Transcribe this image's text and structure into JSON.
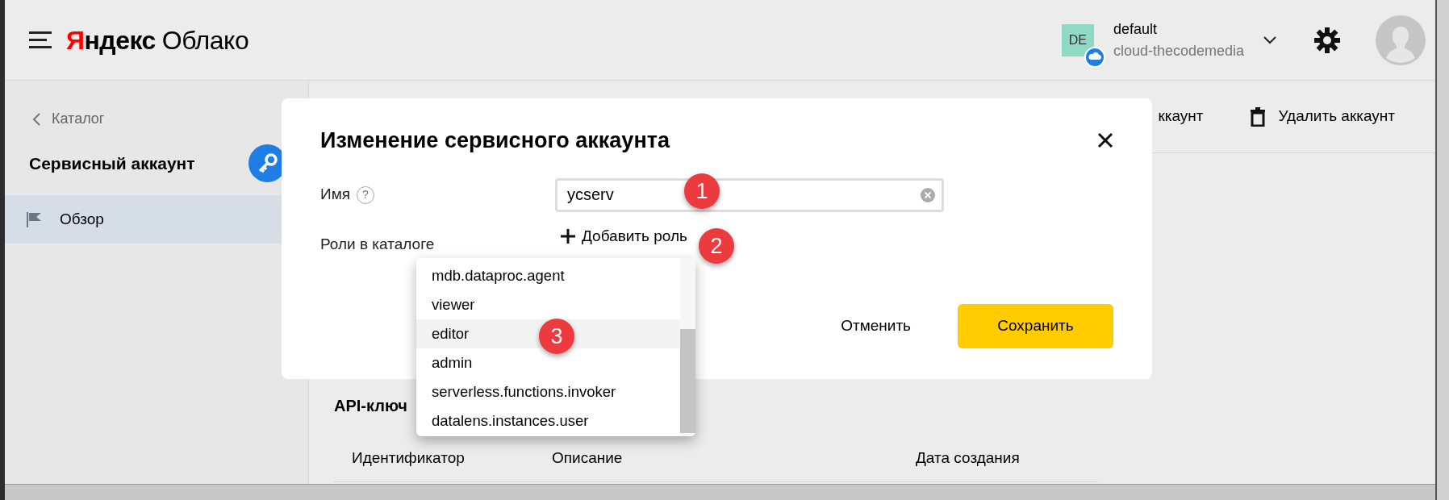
{
  "header": {
    "logo": {
      "brand": "Яндекс",
      "product": "Облако"
    },
    "account": {
      "initials": "DE",
      "name": "default",
      "cloud": "cloud-thecodemedia"
    }
  },
  "sidebar": {
    "back": "Каталог",
    "title": "Сервисный аккаунт",
    "items": [
      {
        "label": "Обзор",
        "selected": true
      }
    ]
  },
  "actions": [
    {
      "kind": "partial",
      "label": "ккаунт"
    },
    {
      "kind": "trash",
      "label": "Удалить аккаунт"
    }
  ],
  "section": {
    "title": "API-ключ",
    "columns": [
      "Идентификатор",
      "Описание",
      "Дата создания"
    ]
  },
  "modal": {
    "title": "Изменение сервисного аккаунта",
    "name_label": "Имя",
    "help": "?",
    "name_value": "ycserv",
    "roles_label": "Роли в каталоге",
    "add_role": "Добавить роль",
    "buttons": [
      {
        "kind": "cancel",
        "label": "Отменить"
      },
      {
        "kind": "save",
        "label": "Сохранить"
      }
    ]
  },
  "dropdown": {
    "items": [
      {
        "label": "mdb.dataproc.agent",
        "selected": false
      },
      {
        "label": "viewer",
        "selected": false
      },
      {
        "label": "editor",
        "selected": true
      },
      {
        "label": "admin",
        "selected": false
      },
      {
        "label": "serverless.functions.invoker",
        "selected": false
      },
      {
        "label": "datalens.instances.user",
        "selected": false
      }
    ]
  },
  "annotations": [
    {
      "label": "1"
    },
    {
      "label": "2"
    },
    {
      "label": "3"
    }
  ]
}
